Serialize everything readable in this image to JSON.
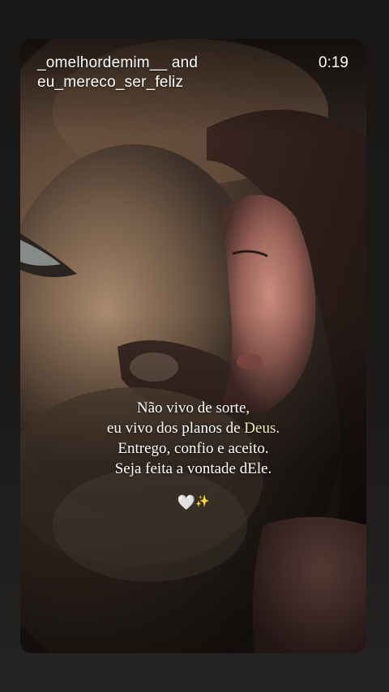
{
  "story": {
    "title_line1": "_omelhordemim__ and",
    "title_line2": "eu_mereco_ser_feliz",
    "time": "0:19"
  },
  "quote": {
    "line1": "Não vivo de sorte,",
    "line2_prefix": "eu vivo dos planos de ",
    "line2_highlight": "Deus.",
    "line3": "Entrego, confio e aceito.",
    "line4": "Seja feita a vontade dEle."
  },
  "emoji": {
    "heart": "🤍",
    "sparkle": "✨"
  },
  "colors": {
    "background": "#1b1918",
    "highlight": "#f3e7b0",
    "text": "#ffffff"
  },
  "image": {
    "subject_icon": "lion-and-woman-photo"
  }
}
